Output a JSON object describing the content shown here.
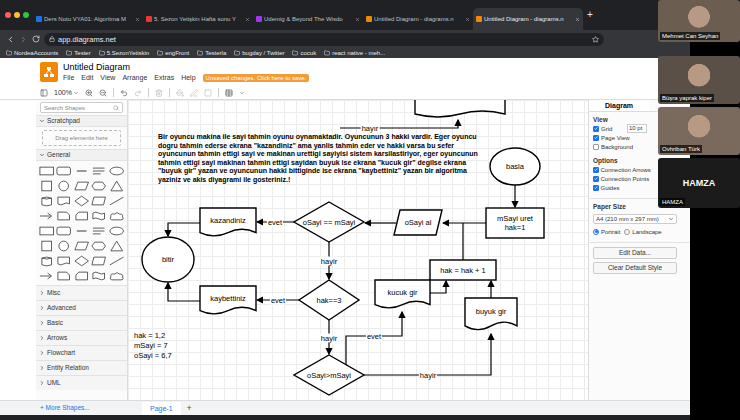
{
  "browser": {
    "tabs": [
      {
        "label": "Ders Notu VYA01: Algoritma M",
        "selected": false
      },
      {
        "label": "5. Sezon Yetişkin Hafta sonu Y",
        "selected": false
      },
      {
        "label": "Udemig & Beyond The Wisdo",
        "selected": false
      },
      {
        "label": "Untitled Diagram - diagrams.n",
        "selected": false
      },
      {
        "label": "Untitled Diagram - diagrams.n",
        "selected": true
      }
    ],
    "new_tab": "+",
    "address": "app.diagrams.net",
    "bookmarks": [
      "NordeaAccounts",
      "Tester",
      "5.SezonYetiskin",
      "engFront",
      "Testerla",
      "bugday / Twitter",
      "cocuk",
      "react native - meh..."
    ]
  },
  "app": {
    "title": "Untitled Diagram",
    "menu": [
      "File",
      "Edit",
      "View",
      "Arrange",
      "Extras",
      "Help"
    ],
    "unsaved": "Unsaved changes. Click here to save.",
    "zoom": "100%"
  },
  "sidebar": {
    "search": "Search Shapes",
    "scratchpad": "Scratchpad",
    "drop_hint": "Drag elements here",
    "general": "General",
    "sections": [
      "Misc",
      "Advanced",
      "Basic",
      "Arrows",
      "Flowchart",
      "Entity Relation",
      "UML"
    ],
    "more": "+ More Shapes..."
  },
  "canvas": {
    "problem": "Bir oyuncu makina ile sayi tahmin oyunu oynamaktadir. Oyuncunun 3 hakki vardir. Eger oyuncu dogru tahmin ederse ekrana \"kazandiniz\" ama yanlis tahmin eder ve hakki varsa bu sefer oyuncunun tahmin ettigi sayi ve makinan urettigi sayiyisi sistem karsilastiriyor, eger oyuncunun tahmin ettigi sayi makinan tahmin ettigi sayidan buyuk ise ekrana \"kucuk gir\" degilse ekrana \"buyuk gir\" yazan ve oyuncunun hakki bittiginde ise ekrana \"kaybettiniz\" yazan bir algoritma yaziniz ve akis diyagrami ile gosteriniz.!",
    "nodes": [
      {
        "text": "basla",
        "kind": "ellipse"
      },
      {
        "text": "mSayi uret\nhak=1",
        "kind": "process"
      },
      {
        "text": "oSayi al",
        "kind": "io"
      },
      {
        "text": "oSayi == mSayi",
        "kind": "decision"
      },
      {
        "text": "kazandiniz",
        "kind": "document"
      },
      {
        "text": "bitir",
        "kind": "terminal"
      },
      {
        "text": "hak = hak + 1",
        "kind": "process"
      },
      {
        "text": "hak==3",
        "kind": "decision"
      },
      {
        "text": "kaybettiniz",
        "kind": "document"
      },
      {
        "text": "kucuk gir",
        "kind": "document"
      },
      {
        "text": "buyuk gir",
        "kind": "document"
      },
      {
        "text": "oSayi>mSayi",
        "kind": "decision"
      }
    ],
    "edge_labels": [
      "evet",
      "hayir",
      "evet",
      "hayir",
      "evet",
      "hayir",
      "hayır"
    ],
    "notes": [
      "hak = 1,2",
      "mSayi = 7",
      "oSayi = 6,7"
    ]
  },
  "format_panel": {
    "tabs": [
      {
        "label": "Diagram",
        "selected": true
      }
    ],
    "view": "View",
    "view_options": [
      {
        "label": "Grid",
        "checked": true,
        "value": "10 pt"
      },
      {
        "label": "Page View",
        "checked": true
      },
      {
        "label": "Background",
        "checked": false
      }
    ],
    "options": "Options",
    "option_items": [
      {
        "label": "Connection Arrows",
        "checked": true
      },
      {
        "label": "Connection Points",
        "checked": true
      },
      {
        "label": "Guides",
        "checked": true
      }
    ],
    "paper_size": "Paper Size",
    "paper": "A4 (210 mm x 297 mm)",
    "orientations": [
      {
        "label": "Portrait",
        "selected": true
      },
      {
        "label": "Landscape",
        "selected": false
      }
    ],
    "buttons": [
      "Edit Data...",
      "Clear Default Style"
    ]
  },
  "pages": {
    "tabs": [
      {
        "label": "Page-1",
        "selected": true
      }
    ],
    "add": "+"
  },
  "call": {
    "participants": [
      {
        "name": "Mehmet Can Seyhan",
        "camera": true
      },
      {
        "name": "Büşra yaprak kiper",
        "camera": true
      },
      {
        "name": "Ovhriban Türk",
        "camera": true
      },
      {
        "name": "HAMZA",
        "camera": false,
        "avatar_text": "HAMZA"
      }
    ]
  }
}
